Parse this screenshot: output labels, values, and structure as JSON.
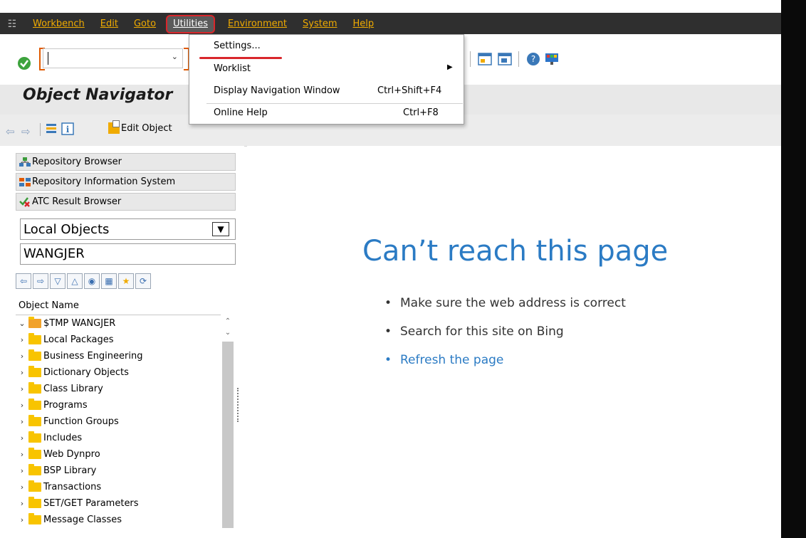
{
  "menubar": {
    "items": [
      "Workbench",
      "Edit",
      "Goto",
      "Utilities",
      "Environment",
      "System",
      "Help"
    ],
    "active": "Utilities"
  },
  "dropdown": {
    "items": [
      {
        "label": "Settings...",
        "shortcut": ""
      },
      {
        "label": "Worklist",
        "shortcut": ""
      },
      {
        "label": "Display Navigation Window",
        "shortcut": "Ctrl+Shift+F4"
      },
      {
        "label": "Online Help",
        "shortcut": "Ctrl+F8"
      }
    ]
  },
  "title": "Object Navigator",
  "app_toolbar": {
    "edit_object": "Edit Object"
  },
  "left_pane": {
    "tabs": [
      "Repository Browser",
      "Repository Information System",
      "ATC Result Browser"
    ],
    "object_type": "Local Objects",
    "object_name": "WANGJER",
    "tree_header": "Object Name",
    "tree_root": "$TMP WANGJER",
    "tree_items": [
      "Local Packages",
      "Business Engineering",
      "Dictionary Objects",
      "Class Library",
      "Programs",
      "Function Groups",
      "Includes",
      "Web Dynpro",
      "BSP Library",
      "Transactions",
      "SET/GET Parameters",
      "Message Classes"
    ]
  },
  "error_page": {
    "heading": "Can’t reach this page",
    "bullets": [
      "Make sure the web address is correct",
      "Search for this site on Bing"
    ],
    "link": "Refresh the page"
  },
  "colors": {
    "menu_text": "#f0ab00",
    "highlight_red": "#d9262b",
    "link_blue": "#2b7bc4",
    "folder_yellow": "#f8c400"
  },
  "icons": [
    "sap-menu-icon",
    "ok-check-icon",
    "dropdown-arrow-icon",
    "back-arrow-icon",
    "forward-arrow-icon",
    "hierarchy-icon",
    "info-icon",
    "edit-object-icon",
    "help-icon",
    "layout-icon",
    "new-session-icon"
  ]
}
